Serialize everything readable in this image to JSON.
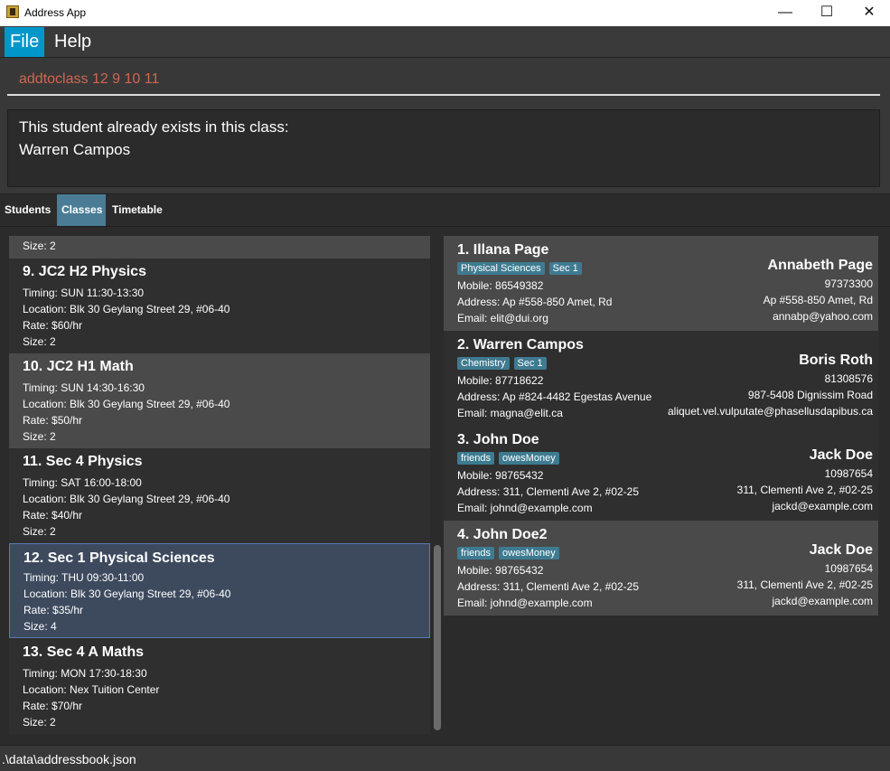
{
  "window": {
    "title": "Address App",
    "minimize": "—",
    "maximize": "☐",
    "close": "✕"
  },
  "menu": {
    "file": "File",
    "help": "Help"
  },
  "command": {
    "value": "addtoclass 12 9 10 11"
  },
  "result": {
    "line1": "This student already exists in this class:",
    "line2": "Warren Campos"
  },
  "tabs": [
    "Students",
    "Classes",
    "Timetable"
  ],
  "partial_class": {
    "size": "Size: 2"
  },
  "classes": [
    {
      "name": "9.  JC2 H2 Physics",
      "timing": "Timing: SUN 11:30-13:30",
      "location": "Location: Blk 30 Geylang Street 29, #06-40",
      "rate": "Rate: $60/hr",
      "size": "Size: 2"
    },
    {
      "name": "10.  JC2 H1 Math",
      "timing": "Timing: SUN 14:30-16:30",
      "location": "Location: Blk 30 Geylang Street 29, #06-40",
      "rate": "Rate: $50/hr",
      "size": "Size: 2"
    },
    {
      "name": "11.  Sec 4 Physics",
      "timing": "Timing: SAT 16:00-18:00",
      "location": "Location: Blk 30 Geylang Street 29, #06-40",
      "rate": "Rate: $40/hr",
      "size": "Size: 2"
    },
    {
      "name": "12.  Sec 1 Physical Sciences",
      "timing": "Timing: THU 09:30-11:00",
      "location": "Location: Blk 30 Geylang Street 29, #06-40",
      "rate": "Rate: $35/hr",
      "size": "Size: 4"
    },
    {
      "name": "13.  Sec 4 A Maths",
      "timing": "Timing: MON 17:30-18:30",
      "location": "Location: Nex Tuition Center",
      "rate": "Rate: $70/hr",
      "size": "Size: 2"
    }
  ],
  "students": [
    {
      "name": "1.  Illana Page",
      "tags": [
        "Physical Sciences",
        "Sec 1"
      ],
      "mobile": "Mobile: 86549382",
      "address": "Address: Ap #558-850 Amet, Rd",
      "email": "Email: elit@dui.org",
      "parent": {
        "name": "Annabeth Page",
        "phone": "97373300",
        "address": "Ap #558-850 Amet, Rd",
        "email": "annabp@yahoo.com"
      }
    },
    {
      "name": "2.  Warren Campos",
      "tags": [
        "Chemistry",
        "Sec 1"
      ],
      "mobile": "Mobile: 87718622",
      "address": "Address: Ap #824-4482 Egestas Avenue",
      "email": "Email: magna@elit.ca",
      "parent": {
        "name": "Boris Roth",
        "phone": "81308576",
        "address": "987-5408 Dignissim Road",
        "email": "aliquet.vel.vulputate@phasellusdapibus.ca"
      }
    },
    {
      "name": "3.  John Doe",
      "tags": [
        "friends",
        "owesMoney"
      ],
      "mobile": "Mobile: 98765432",
      "address": "Address: 311, Clementi Ave 2, #02-25",
      "email": "Email: johnd@example.com",
      "parent": {
        "name": "Jack Doe",
        "phone": "10987654",
        "address": "311, Clementi Ave 2, #02-25",
        "email": "jackd@example.com"
      }
    },
    {
      "name": "4.  John Doe2",
      "tags": [
        "friends",
        "owesMoney"
      ],
      "mobile": "Mobile: 98765432",
      "address": "Address: 311, Clementi Ave 2, #02-25",
      "email": "Email: johnd@example.com",
      "parent": {
        "name": "Jack Doe",
        "phone": "10987654",
        "address": "311, Clementi Ave 2, #02-25",
        "email": "jackd@example.com"
      }
    }
  ],
  "status": {
    "path": ".\\data\\addressbook.json"
  },
  "colors": {
    "accent": "#0096c9",
    "command_text": "#d06651",
    "tag": "#3e7b91",
    "selected_tab": "#4a7d95"
  }
}
